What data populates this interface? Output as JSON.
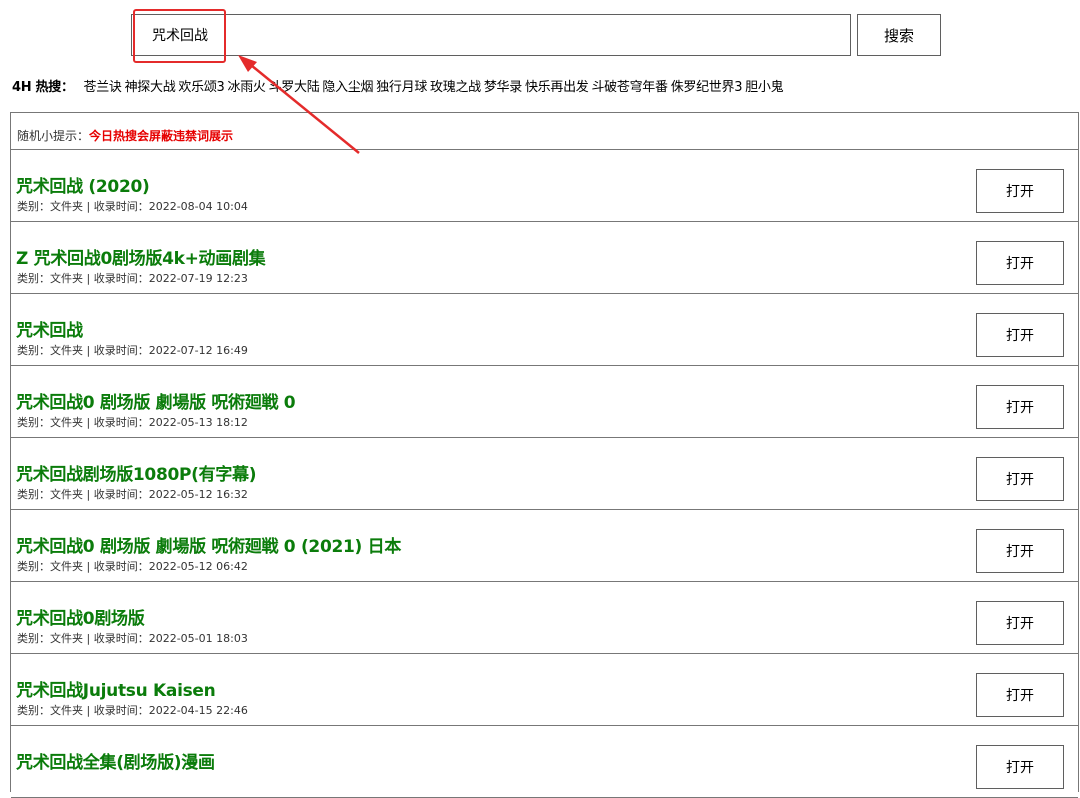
{
  "search": {
    "value": "咒术回战",
    "button_label": "搜索"
  },
  "hot": {
    "label": "4H 热搜：",
    "items": [
      "苍兰诀",
      "神探大战",
      "欢乐颂3",
      "冰雨火",
      "斗罗大陆",
      "隐入尘烟",
      "独行月球",
      "玫瑰之战",
      "梦华录",
      "快乐再出发",
      "斗破苍穹年番",
      "侏罗纪世界3",
      "胆小鬼"
    ]
  },
  "tip": {
    "label": "随机小提示：",
    "text": "今日热搜会屏蔽违禁词展示"
  },
  "results": [
    {
      "title": "咒术回战 (2020)",
      "meta": "类别：文件夹 | 收录时间：2022-08-04 10:04",
      "button": "打开"
    },
    {
      "title": "Z 咒术回战0剧场版4k+动画剧集",
      "meta": "类别：文件夹 | 收录时间：2022-07-19 12:23",
      "button": "打开"
    },
    {
      "title": "咒术回战",
      "meta": "类别：文件夹 | 收录时间：2022-07-12 16:49",
      "button": "打开"
    },
    {
      "title": "咒术回战0 剧场版 劇場版 呪術廻戦 0",
      "meta": "类别：文件夹 | 收录时间：2022-05-13 18:12",
      "button": "打开"
    },
    {
      "title": "咒术回战剧场版1080P(有字幕)",
      "meta": "类别：文件夹 | 收录时间：2022-05-12 16:32",
      "button": "打开"
    },
    {
      "title": "咒术回战0 剧场版 劇場版 呪術廻戦 0 (2021) 日本",
      "meta": "类别：文件夹 | 收录时间：2022-05-12 06:42",
      "button": "打开"
    },
    {
      "title": "咒术回战0剧场版",
      "meta": "类别：文件夹 | 收录时间：2022-05-01 18:03",
      "button": "打开"
    },
    {
      "title": "咒术回战Jujutsu Kaisen",
      "meta": "类别：文件夹 | 收录时间：2022-04-15 22:46",
      "button": "打开"
    },
    {
      "title": "咒术回战全集(剧场版)漫画",
      "meta": "",
      "button": "打开"
    }
  ],
  "colors": {
    "title_green": "#0b7c0b",
    "tip_red": "#e60000",
    "annotation_red": "#e42b2b"
  }
}
